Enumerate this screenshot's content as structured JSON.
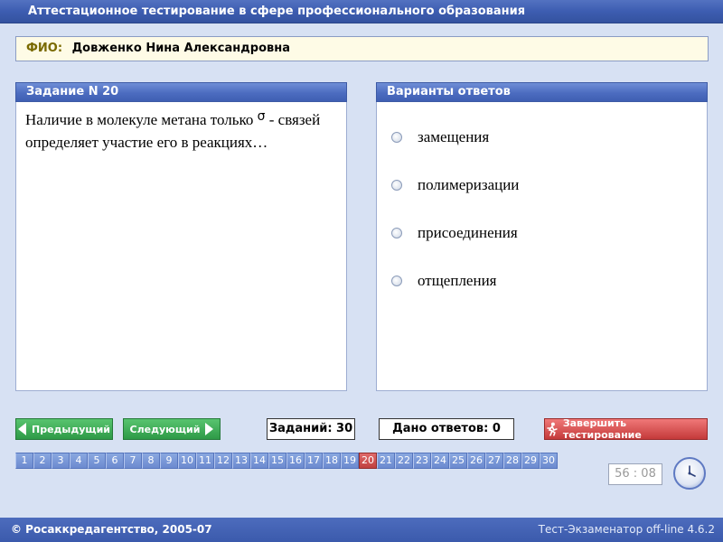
{
  "window": {
    "title": "Аттестационное тестирование в сфере профессионального образования"
  },
  "fio": {
    "label": "ФИО:",
    "name": "Довженко Нина Александровна"
  },
  "question": {
    "header": "Задание N 20",
    "text_part1": "Наличие в молекуле метана только ",
    "symbol": "σ",
    "text_part2": " - связей определяет участие его в реакциях…"
  },
  "answers": {
    "header": "Варианты ответов",
    "items": [
      "замещения",
      "полимеризации",
      "присоединения",
      "отщепления"
    ]
  },
  "nav": {
    "prev_label": "Предыдущий",
    "next_label": "Следующий"
  },
  "counters": {
    "tasks": "Заданий: 30",
    "answered": "Дано ответов: 0"
  },
  "finish_label": "Завершить тестирование",
  "pager": {
    "pages": [
      "1",
      "2",
      "3",
      "4",
      "5",
      "6",
      "7",
      "8",
      "9",
      "10",
      "11",
      "12",
      "13",
      "14",
      "15",
      "16",
      "17",
      "18",
      "19",
      "20",
      "21",
      "22",
      "23",
      "24",
      "25",
      "26",
      "27",
      "28",
      "29",
      "30"
    ],
    "current": "20"
  },
  "timer": "56 : 08",
  "footer": {
    "left": "© Росаккредагентство, 2005-07",
    "right": "Тест-Экзаменатор off-line 4.6.2"
  },
  "colors": {
    "accent": "#3d5db1",
    "active_page": "#c04040",
    "nav_button": "#2e9a47",
    "finish_button": "#c43a3a"
  },
  "icons": {
    "prev": "triangle-left-icon",
    "next": "triangle-right-icon",
    "finish": "running-man-icon",
    "timer": "clock-icon"
  }
}
